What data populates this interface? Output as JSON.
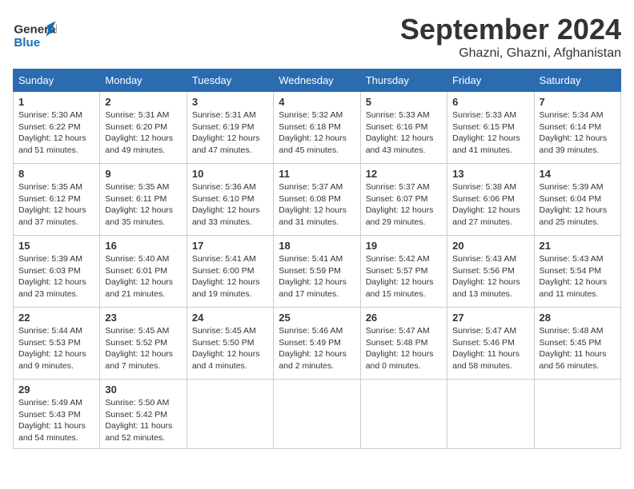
{
  "header": {
    "logo_line1": "General",
    "logo_line2": "Blue",
    "month": "September 2024",
    "location": "Ghazni, Ghazni, Afghanistan"
  },
  "weekdays": [
    "Sunday",
    "Monday",
    "Tuesday",
    "Wednesday",
    "Thursday",
    "Friday",
    "Saturday"
  ],
  "weeks": [
    [
      {
        "day": "1",
        "info": "Sunrise: 5:30 AM\nSunset: 6:22 PM\nDaylight: 12 hours\nand 51 minutes."
      },
      {
        "day": "2",
        "info": "Sunrise: 5:31 AM\nSunset: 6:20 PM\nDaylight: 12 hours\nand 49 minutes."
      },
      {
        "day": "3",
        "info": "Sunrise: 5:31 AM\nSunset: 6:19 PM\nDaylight: 12 hours\nand 47 minutes."
      },
      {
        "day": "4",
        "info": "Sunrise: 5:32 AM\nSunset: 6:18 PM\nDaylight: 12 hours\nand 45 minutes."
      },
      {
        "day": "5",
        "info": "Sunrise: 5:33 AM\nSunset: 6:16 PM\nDaylight: 12 hours\nand 43 minutes."
      },
      {
        "day": "6",
        "info": "Sunrise: 5:33 AM\nSunset: 6:15 PM\nDaylight: 12 hours\nand 41 minutes."
      },
      {
        "day": "7",
        "info": "Sunrise: 5:34 AM\nSunset: 6:14 PM\nDaylight: 12 hours\nand 39 minutes."
      }
    ],
    [
      {
        "day": "8",
        "info": "Sunrise: 5:35 AM\nSunset: 6:12 PM\nDaylight: 12 hours\nand 37 minutes."
      },
      {
        "day": "9",
        "info": "Sunrise: 5:35 AM\nSunset: 6:11 PM\nDaylight: 12 hours\nand 35 minutes."
      },
      {
        "day": "10",
        "info": "Sunrise: 5:36 AM\nSunset: 6:10 PM\nDaylight: 12 hours\nand 33 minutes."
      },
      {
        "day": "11",
        "info": "Sunrise: 5:37 AM\nSunset: 6:08 PM\nDaylight: 12 hours\nand 31 minutes."
      },
      {
        "day": "12",
        "info": "Sunrise: 5:37 AM\nSunset: 6:07 PM\nDaylight: 12 hours\nand 29 minutes."
      },
      {
        "day": "13",
        "info": "Sunrise: 5:38 AM\nSunset: 6:06 PM\nDaylight: 12 hours\nand 27 minutes."
      },
      {
        "day": "14",
        "info": "Sunrise: 5:39 AM\nSunset: 6:04 PM\nDaylight: 12 hours\nand 25 minutes."
      }
    ],
    [
      {
        "day": "15",
        "info": "Sunrise: 5:39 AM\nSunset: 6:03 PM\nDaylight: 12 hours\nand 23 minutes."
      },
      {
        "day": "16",
        "info": "Sunrise: 5:40 AM\nSunset: 6:01 PM\nDaylight: 12 hours\nand 21 minutes."
      },
      {
        "day": "17",
        "info": "Sunrise: 5:41 AM\nSunset: 6:00 PM\nDaylight: 12 hours\nand 19 minutes."
      },
      {
        "day": "18",
        "info": "Sunrise: 5:41 AM\nSunset: 5:59 PM\nDaylight: 12 hours\nand 17 minutes."
      },
      {
        "day": "19",
        "info": "Sunrise: 5:42 AM\nSunset: 5:57 PM\nDaylight: 12 hours\nand 15 minutes."
      },
      {
        "day": "20",
        "info": "Sunrise: 5:43 AM\nSunset: 5:56 PM\nDaylight: 12 hours\nand 13 minutes."
      },
      {
        "day": "21",
        "info": "Sunrise: 5:43 AM\nSunset: 5:54 PM\nDaylight: 12 hours\nand 11 minutes."
      }
    ],
    [
      {
        "day": "22",
        "info": "Sunrise: 5:44 AM\nSunset: 5:53 PM\nDaylight: 12 hours\nand 9 minutes."
      },
      {
        "day": "23",
        "info": "Sunrise: 5:45 AM\nSunset: 5:52 PM\nDaylight: 12 hours\nand 7 minutes."
      },
      {
        "day": "24",
        "info": "Sunrise: 5:45 AM\nSunset: 5:50 PM\nDaylight: 12 hours\nand 4 minutes."
      },
      {
        "day": "25",
        "info": "Sunrise: 5:46 AM\nSunset: 5:49 PM\nDaylight: 12 hours\nand 2 minutes."
      },
      {
        "day": "26",
        "info": "Sunrise: 5:47 AM\nSunset: 5:48 PM\nDaylight: 12 hours\nand 0 minutes."
      },
      {
        "day": "27",
        "info": "Sunrise: 5:47 AM\nSunset: 5:46 PM\nDaylight: 11 hours\nand 58 minutes."
      },
      {
        "day": "28",
        "info": "Sunrise: 5:48 AM\nSunset: 5:45 PM\nDaylight: 11 hours\nand 56 minutes."
      }
    ],
    [
      {
        "day": "29",
        "info": "Sunrise: 5:49 AM\nSunset: 5:43 PM\nDaylight: 11 hours\nand 54 minutes."
      },
      {
        "day": "30",
        "info": "Sunrise: 5:50 AM\nSunset: 5:42 PM\nDaylight: 11 hours\nand 52 minutes."
      },
      null,
      null,
      null,
      null,
      null
    ]
  ]
}
